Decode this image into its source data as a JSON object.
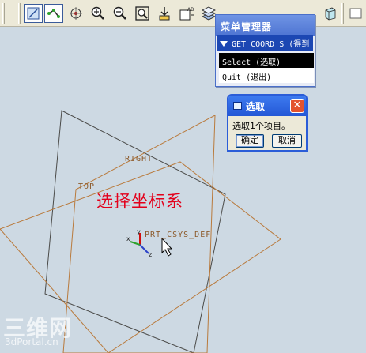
{
  "colors": {
    "viewport_bg": "#cdd9e3",
    "datum_plane": "#b97a3c",
    "dark_plane": "#4a4a48",
    "annotation": "#e3001b",
    "menu_highlight": "#1c47b3",
    "dialog_title": "#2457d6"
  },
  "toolbar": {
    "icons": [
      "view-mode-icon",
      "datum-point-icon",
      "spin-center-icon",
      "zoom-in-icon",
      "zoom-out-icon",
      "refit-icon",
      "reorient-icon",
      "saved-views-icon",
      "layers-icon",
      "shading-icon"
    ]
  },
  "menu_manager": {
    "title": "菜单管理器",
    "header": "GET COORD S (得到",
    "items": [
      {
        "label": "Select (选取)",
        "selected": true
      },
      {
        "label": "Quit (退出)",
        "selected": false
      }
    ]
  },
  "select_dialog": {
    "title": "选取",
    "message": "选取1个项目。",
    "ok_label": "确定",
    "cancel_label": "取消"
  },
  "viewport": {
    "datum_labels": {
      "right": "RIGHT",
      "top": "TOP",
      "csys": "PRT_CSYS_DEF"
    },
    "annotation": "选择坐标系",
    "csys_axis_labels": {
      "x": "x",
      "y": "y",
      "z": "z"
    }
  },
  "watermark": {
    "logo": "三维网",
    "url": "3dPortal.cn"
  }
}
